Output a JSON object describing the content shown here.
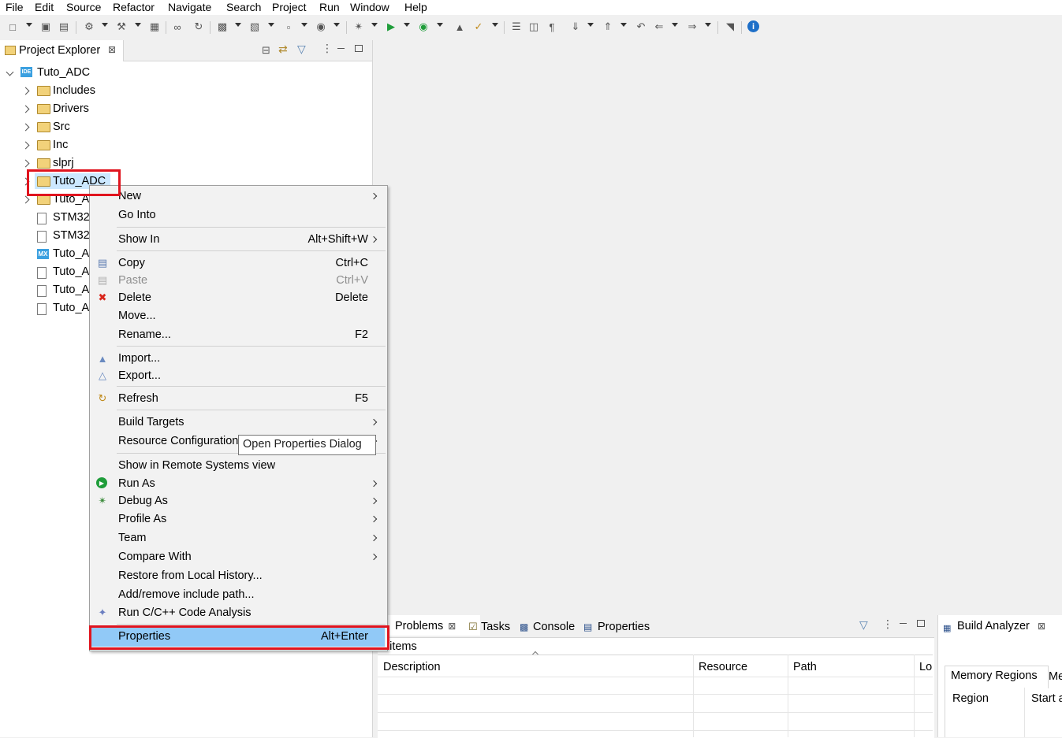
{
  "menubar": [
    "File",
    "Edit",
    "Source",
    "Refactor",
    "Navigate",
    "Search",
    "Project",
    "Run",
    "Window",
    "Help"
  ],
  "explorer": {
    "title": "Project Explorer",
    "close": "⊠",
    "root": "Tuto_ADC",
    "items": [
      {
        "label": "Includes",
        "kind": "includes"
      },
      {
        "label": "Drivers",
        "kind": "folder"
      },
      {
        "label": "Src",
        "kind": "folder"
      },
      {
        "label": "Inc",
        "kind": "folder"
      },
      {
        "label": "slprj",
        "kind": "folder"
      },
      {
        "label": "Tuto_ADC",
        "kind": "folder"
      },
      {
        "label": "Tuto_A",
        "kind": "folder"
      },
      {
        "label": "STM32",
        "kind": "ld"
      },
      {
        "label": "STM32",
        "kind": "ld"
      },
      {
        "label": "Tuto_A",
        "kind": "mx"
      },
      {
        "label": "Tuto_A",
        "kind": "doc"
      },
      {
        "label": "Tuto_A",
        "kind": "doc"
      },
      {
        "label": "Tuto_A",
        "kind": "doc"
      }
    ]
  },
  "context_menu": {
    "items": [
      {
        "label": "New",
        "submenu": true
      },
      {
        "label": "Go Into"
      },
      {
        "label": "Show In",
        "accel": "Alt+Shift+W",
        "submenu": true
      },
      {
        "label": "Copy",
        "accel": "Ctrl+C",
        "icon": "copy-icon"
      },
      {
        "label": "Paste",
        "accel": "Ctrl+V",
        "icon": "paste-icon",
        "disabled": true
      },
      {
        "label": "Delete",
        "accel": "Delete",
        "icon": "delete-icon"
      },
      {
        "label": "Move..."
      },
      {
        "label": "Rename...",
        "accel": "F2"
      },
      {
        "label": "Import...",
        "icon": "import-icon"
      },
      {
        "label": "Export...",
        "icon": "export-icon"
      },
      {
        "label": "Refresh",
        "accel": "F5",
        "icon": "refresh-icon"
      },
      {
        "label": "Build Targets",
        "submenu": true
      },
      {
        "label": "Resource Configuration",
        "submenu": true
      },
      {
        "label": "Show in Remote Systems view"
      },
      {
        "label": "Run As",
        "submenu": true,
        "icon": "run-icon"
      },
      {
        "label": "Debug As",
        "submenu": true,
        "icon": "debug-icon"
      },
      {
        "label": "Profile As",
        "submenu": true
      },
      {
        "label": "Team",
        "submenu": true
      },
      {
        "label": "Compare With",
        "submenu": true
      },
      {
        "label": "Restore from Local History..."
      },
      {
        "label": "Add/remove include path..."
      },
      {
        "label": "Run C/C++ Code Analysis",
        "icon": "code-analysis-icon"
      },
      {
        "label": "Properties",
        "accel": "Alt+Enter",
        "highlighted": true
      }
    ]
  },
  "tooltip": "Open Properties Dialog",
  "problems": {
    "tabs": [
      "Problems",
      "Tasks",
      "Console",
      "Properties"
    ],
    "count": "0 items",
    "columns": [
      "Description",
      "Resource",
      "Path",
      "Lo"
    ]
  },
  "build_analyzer": {
    "title": "Build Analyzer",
    "tabs": [
      "Memory Regions",
      "Me"
    ],
    "columns": [
      "Region",
      "Start a"
    ]
  },
  "colors": {
    "highlight": "#91c9f7",
    "annotation": "#e0141e",
    "accent": "#2a8fd8"
  }
}
